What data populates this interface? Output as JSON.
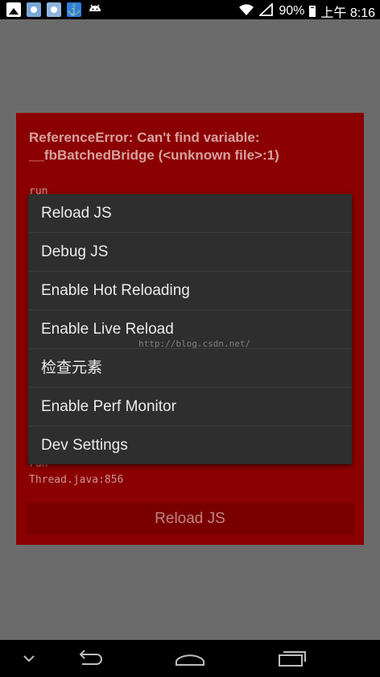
{
  "status_bar": {
    "battery": "90%",
    "time": "上午 8:16",
    "icons": [
      "gallery-icon",
      "app-notification-icon",
      "app-notification-icon",
      "anchor-icon",
      "android-icon",
      "wifi-icon",
      "signal-icon",
      "battery-icon"
    ]
  },
  "error": {
    "title": "ReferenceError: Can't find variable: __fbBatchedBridge (<unknown file>:1)",
    "stack_top": "run",
    "stack_bottom_method": "run",
    "stack_bottom_location": "Thread.java:856",
    "reload_label": "Reload JS"
  },
  "dev_menu": {
    "items": [
      "Reload JS",
      "Debug JS",
      "Enable Hot Reloading",
      "Enable Live Reload",
      "检查元素",
      "Enable Perf Monitor",
      "Dev Settings"
    ]
  },
  "watermark": "http://blog.csdn.net/",
  "nav_bar": {
    "buttons": [
      "chevron-down-icon",
      "back-icon",
      "home-icon",
      "recents-icon"
    ]
  },
  "colors": {
    "error_background": "#8b0000",
    "menu_background": "#2e2e2e",
    "overlay": "#6b6b6b"
  }
}
